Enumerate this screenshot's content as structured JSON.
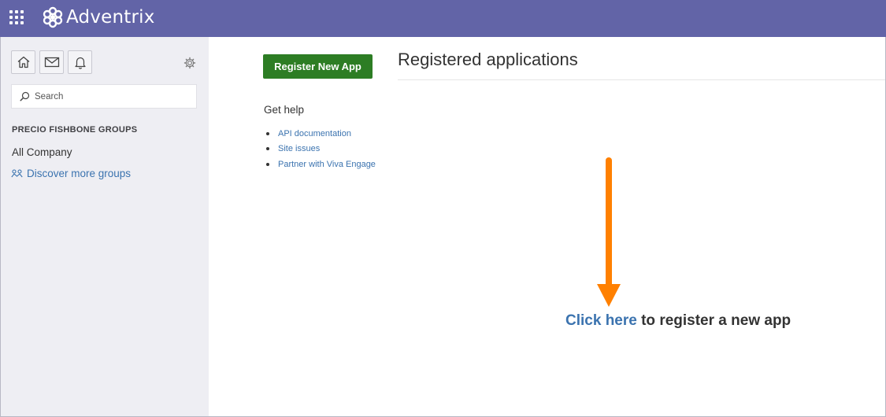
{
  "header": {
    "brand": "Adventrix",
    "app_launcher_icon": "waffle-grid-icon",
    "logo_icon": "adventrix-logo-icon"
  },
  "sidebar": {
    "nav_icons": [
      "home-icon",
      "mail-icon",
      "bell-icon"
    ],
    "settings_icon": "gear-icon",
    "search": {
      "placeholder": "Search"
    },
    "groups_heading": "PRECIO FISHBONE GROUPS",
    "groups": [
      "All Company"
    ],
    "discover_label": "Discover more groups"
  },
  "left_panel": {
    "register_button": "Register New App",
    "get_help_heading": "Get help",
    "help_links": [
      "API documentation",
      "Site issues",
      "Partner with Viva Engage"
    ]
  },
  "main": {
    "title": "Registered applications",
    "cta_link": "Click here",
    "cta_rest": " to register a new app"
  },
  "colors": {
    "topbar": "#6264a7",
    "sidebar_bg": "#eeeef3",
    "primary_button": "#2d7d24",
    "link": "#3b73af",
    "annotation_arrow": "#ff8000"
  }
}
